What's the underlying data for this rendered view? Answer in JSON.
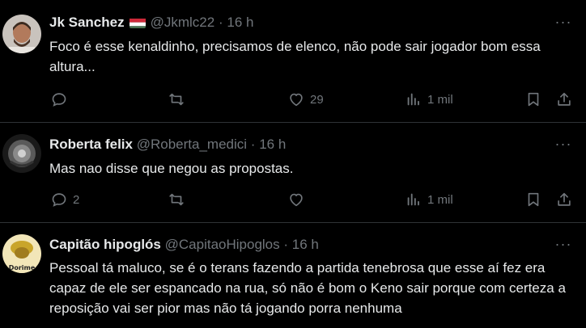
{
  "tweets": [
    {
      "name": "Jk Sanchez",
      "flag": "hungary-flag",
      "handle": "@Jkmlc22",
      "separator": "·",
      "time": "16 h",
      "text": "Foco é esse kenaldinho, precisamos de elenco, não pode sair jogador bom essa altura...",
      "replies": "",
      "retweets": "",
      "likes": "29",
      "views": "1 mil"
    },
    {
      "name": "Roberta felix",
      "handle": "@Roberta_medici",
      "separator": "·",
      "time": "16 h",
      "text": "Mas nao disse que negou as propostas.",
      "replies": "2",
      "retweets": "",
      "likes": "",
      "views": "1 mil"
    },
    {
      "name": "Capitão hipoglós",
      "handle": "@CapitaoHipoglos",
      "separator": "·",
      "time": "16 h",
      "text": "Pessoal tá maluco, se é o terans fazendo a partida tenebrosa que esse aí fez era capaz de ele ser espancado na rua, só não é bom o Keno sair porque com certeza a reposição vai ser pior mas não tá jogando porra nenhuma",
      "avatar_text": "Dorime"
    }
  ],
  "more_label": "···",
  "colors": {
    "background": "#000000",
    "text": "#e7e9ea",
    "muted": "#71767b",
    "divider": "#2f3336"
  }
}
